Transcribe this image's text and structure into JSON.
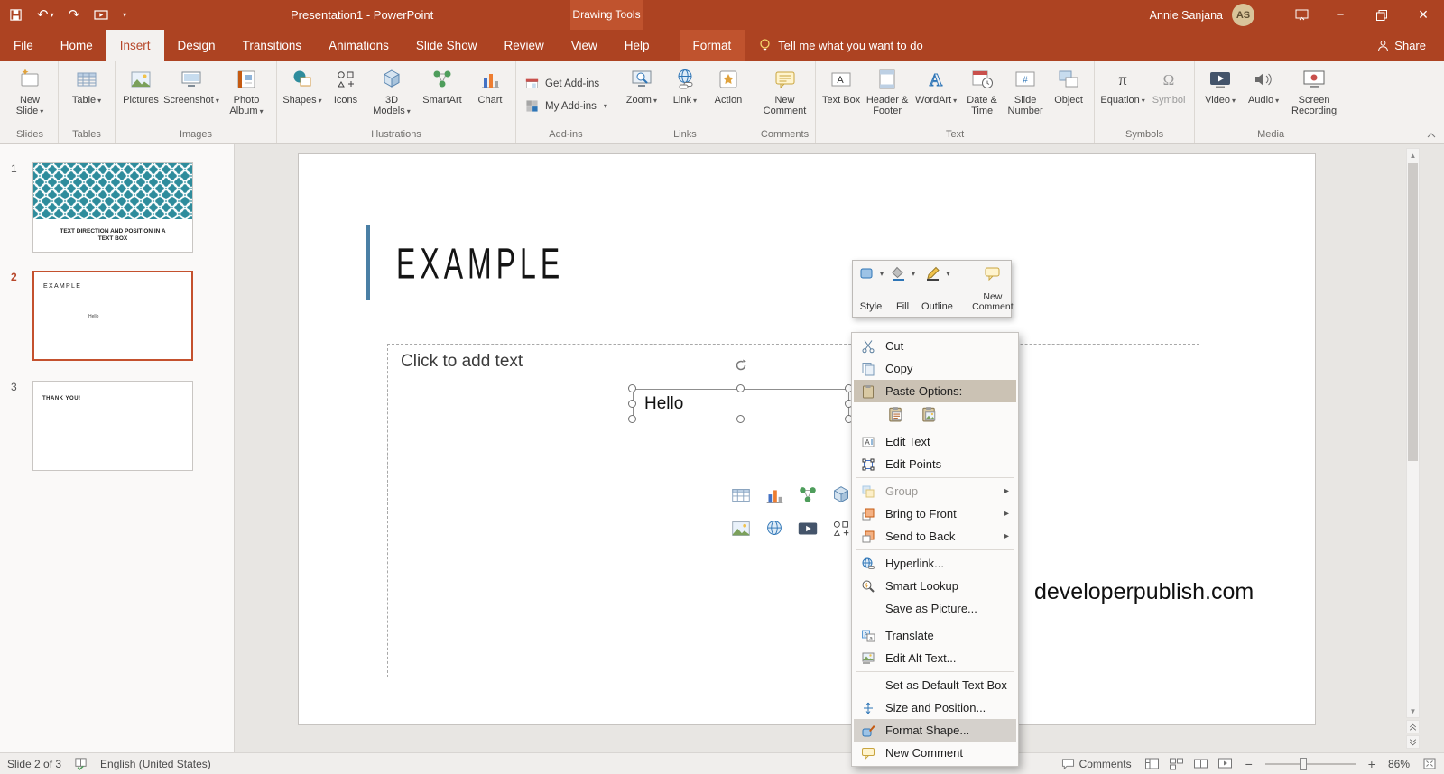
{
  "titlebar": {
    "title": "Presentation1 - PowerPoint",
    "context_group": "Drawing Tools",
    "user_name": "Annie Sanjana",
    "user_initials": "AS"
  },
  "tabs": {
    "items": [
      "File",
      "Home",
      "Insert",
      "Design",
      "Transitions",
      "Animations",
      "Slide Show",
      "Review",
      "View",
      "Help"
    ],
    "format": "Format",
    "tell_me": "Tell me what you want to do",
    "share": "Share"
  },
  "ribbon": {
    "groups": [
      {
        "label": "Slides",
        "buttons": [
          {
            "label": "New Slide"
          }
        ]
      },
      {
        "label": "Tables",
        "buttons": [
          {
            "label": "Table"
          }
        ]
      },
      {
        "label": "Images",
        "buttons": [
          {
            "label": "Pictures"
          },
          {
            "label": "Screenshot"
          },
          {
            "label": "Photo Album"
          }
        ]
      },
      {
        "label": "Illustrations",
        "buttons": [
          {
            "label": "Shapes"
          },
          {
            "label": "Icons"
          },
          {
            "label": "3D Models"
          },
          {
            "label": "SmartArt"
          },
          {
            "label": "Chart"
          }
        ]
      },
      {
        "label": "Add-ins",
        "buttons": [
          {
            "label": "Get Add-ins"
          },
          {
            "label": "My Add-ins"
          }
        ]
      },
      {
        "label": "Links",
        "buttons": [
          {
            "label": "Zoom"
          },
          {
            "label": "Link"
          },
          {
            "label": "Action"
          }
        ]
      },
      {
        "label": "Comments",
        "buttons": [
          {
            "label": "New Comment"
          }
        ]
      },
      {
        "label": "Text",
        "buttons": [
          {
            "label": "Text Box"
          },
          {
            "label": "Header & Footer"
          },
          {
            "label": "WordArt"
          },
          {
            "label": "Date & Time"
          },
          {
            "label": "Slide Number"
          },
          {
            "label": "Object"
          }
        ]
      },
      {
        "label": "Symbols",
        "buttons": [
          {
            "label": "Equation"
          },
          {
            "label": "Symbol"
          }
        ]
      },
      {
        "label": "Media",
        "buttons": [
          {
            "label": "Video"
          },
          {
            "label": "Audio"
          },
          {
            "label": "Screen Recording"
          }
        ]
      }
    ]
  },
  "slide_panel": {
    "slides": [
      {
        "number": "1",
        "caption_line1": "TEXT DIRECTION AND POSITION IN A",
        "caption_line2": "TEXT BOX"
      },
      {
        "number": "2",
        "title": "EXAMPLE",
        "body": "Hello"
      },
      {
        "number": "3",
        "title": "THANK YOU!"
      }
    ]
  },
  "slide": {
    "title": "EXAMPLE",
    "body_placeholder": "Click to add text",
    "textbox_text": "Hello",
    "watermark": "developerpublish.com"
  },
  "mini_toolbar": {
    "style_label": "Style",
    "fill_label": "Fill",
    "outline_label": "Outline",
    "new_comment_label": "New Comment"
  },
  "context_menu": {
    "items": [
      {
        "label": "Cut"
      },
      {
        "label": "Copy"
      },
      {
        "label": "Paste Options:"
      },
      {
        "label": "Edit Text"
      },
      {
        "label": "Edit Points"
      },
      {
        "label": "Group",
        "disabled": true
      },
      {
        "label": "Bring to Front"
      },
      {
        "label": "Send to Back"
      },
      {
        "label": "Hyperlink..."
      },
      {
        "label": "Smart Lookup"
      },
      {
        "label": "Save as Picture..."
      },
      {
        "label": "Translate"
      },
      {
        "label": "Edit Alt Text..."
      },
      {
        "label": "Set as Default Text Box"
      },
      {
        "label": "Size and Position..."
      },
      {
        "label": "Format Shape...",
        "highlighted": true
      },
      {
        "label": "New Comment"
      }
    ]
  },
  "status_bar": {
    "slide_indicator": "Slide 2 of 3",
    "language": "English (United States)",
    "comments_label": "Comments",
    "zoom_level": "86%"
  },
  "colors": {
    "accent_red": "#AD4322",
    "context_tab": "#C0532E",
    "selection_border": "#C4512E",
    "thumbnail_teal": "#2E8C9C",
    "accent_blue_bar": "#4A7FA5"
  }
}
